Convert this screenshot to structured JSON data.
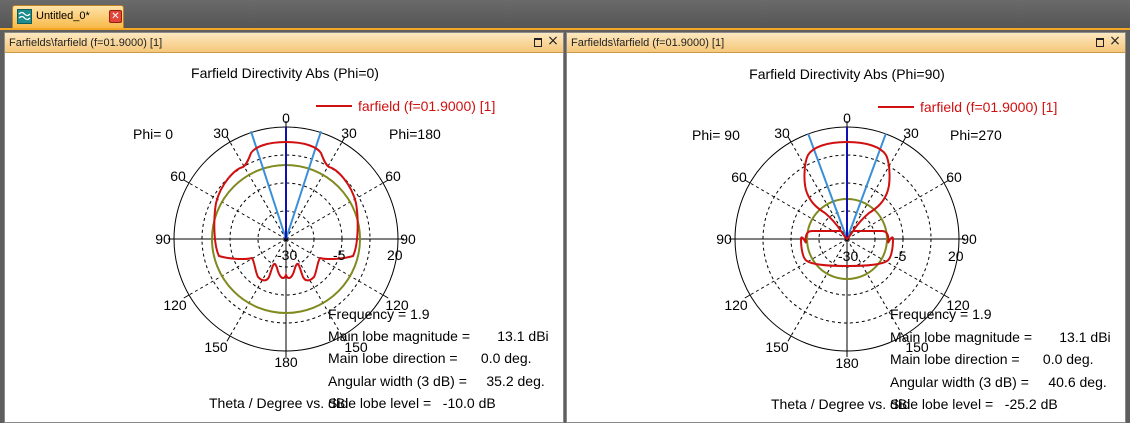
{
  "document_tab": {
    "label": "Untitled_0*",
    "close_glyph": "✕",
    "icon": "farfield-app-icon"
  },
  "plots": [
    {
      "panel_title": "Farfields\\farfield (f=01.9000) [1]",
      "plot_title": "Farfield Directivity Abs (Phi=0)",
      "legend": "farfield (f=01.9000) [1]",
      "phi_left": "Phi=  0",
      "phi_right": "Phi=180",
      "angle_labels": {
        "a0": "0",
        "a30l": "30",
        "a30r": "30",
        "a60l": "60",
        "a60r": "60",
        "a90l": "90",
        "a90r": "90",
        "a120l": "120",
        "a120r": "120",
        "a150l": "150",
        "a150r": "150",
        "a180": "180"
      },
      "radial_labels": {
        "r20": "20",
        "r5": "-5",
        "r30": "-30"
      },
      "axis_label": "Theta / Degree vs. dBi",
      "info": {
        "frequency": "Frequency = 1.9",
        "main_mag": "Main lobe magnitude =       13.1 dBi",
        "main_dir": "Main lobe direction =      0.0 deg.",
        "width": "Angular width (3 dB) =     35.2 deg.",
        "sidelobe": "Side lobe level =   -10.0 dB"
      }
    },
    {
      "panel_title": "Farfields\\farfield (f=01.9000) [1]",
      "plot_title": "Farfield Directivity Abs (Phi=90)",
      "legend": "farfield (f=01.9000) [1]",
      "phi_left": "Phi= 90",
      "phi_right": "Phi=270",
      "angle_labels": {
        "a0": "0",
        "a30l": "30",
        "a30r": "30",
        "a60l": "60",
        "a60r": "60",
        "a90l": "90",
        "a90r": "90",
        "a120l": "120",
        "a120r": "120",
        "a150l": "150",
        "a150r": "150",
        "a180": "180"
      },
      "radial_labels": {
        "r20": "20",
        "r5": "-5",
        "r30": "-30"
      },
      "axis_label": "Theta / Degree vs. dBi",
      "info": {
        "frequency": "Frequency = 1.9",
        "main_mag": "Main lobe magnitude =       13.1 dBi",
        "main_dir": "Main lobe direction =      0.0 deg.",
        "width": "Angular width (3 dB) =     40.6 deg.",
        "sidelobe": "Side lobe level =   -25.2 dB"
      }
    }
  ],
  "chart_data": [
    {
      "type": "polar",
      "title": "Farfield Directivity Abs (Phi=0)",
      "angle_ticks_deg": [
        0,
        30,
        60,
        90,
        120,
        150,
        180
      ],
      "radial_tick_labels": [
        "20",
        "-5",
        "-30"
      ],
      "series": [
        {
          "name": "farfield (f=01.9000) [1]",
          "color": "#d01010",
          "points": [
            [
              0,
              13.1
            ],
            [
              15,
              12.5
            ],
            [
              30,
              10.2
            ],
            [
              45,
              8.5
            ],
            [
              60,
              8.0
            ],
            [
              75,
              7.6
            ],
            [
              90,
              6.5
            ],
            [
              105,
              3.5
            ],
            [
              120,
              -4
            ],
            [
              135,
              -15
            ],
            [
              150,
              -13
            ],
            [
              165,
              -14
            ],
            [
              180,
              -16
            ]
          ]
        }
      ],
      "main_lobe_magnitude_dbi": 13.1,
      "main_lobe_direction_deg": 0.0,
      "angular_width_3db_deg": 35.2,
      "side_lobe_level_db": -10.0,
      "frequency": 1.9,
      "colors": {
        "curve": "#d01010",
        "reference_circle": "#808a1e",
        "main_lobe_line": "#1010b0",
        "beamwidth_lines": "#3a8fd8"
      }
    },
    {
      "type": "polar",
      "title": "Farfield Directivity Abs (Phi=90)",
      "angle_ticks_deg": [
        0,
        30,
        60,
        90,
        120,
        150,
        180
      ],
      "radial_tick_labels": [
        "20",
        "-5",
        "-30"
      ],
      "series": [
        {
          "name": "farfield (f=01.9000) [1]",
          "color": "#d01010",
          "points": [
            [
              0,
              13.1
            ],
            [
              15,
              12.8
            ],
            [
              30,
              11.5
            ],
            [
              40,
              10.5
            ],
            [
              50,
              7
            ],
            [
              60,
              -4
            ],
            [
              75,
              -13
            ],
            [
              90,
              -17
            ],
            [
              100,
              -20
            ],
            [
              110,
              -28
            ],
            [
              120,
              -30
            ],
            [
              135,
              -28
            ],
            [
              150,
              -30
            ],
            [
              180,
              -30
            ]
          ]
        }
      ],
      "main_lobe_magnitude_dbi": 13.1,
      "main_lobe_direction_deg": 0.0,
      "angular_width_3db_deg": 40.6,
      "side_lobe_level_db": -25.2,
      "frequency": 1.9,
      "colors": {
        "curve": "#d01010",
        "reference_circle": "#808a1e",
        "main_lobe_line": "#1010b0",
        "beamwidth_lines": "#3a8fd8"
      }
    }
  ]
}
